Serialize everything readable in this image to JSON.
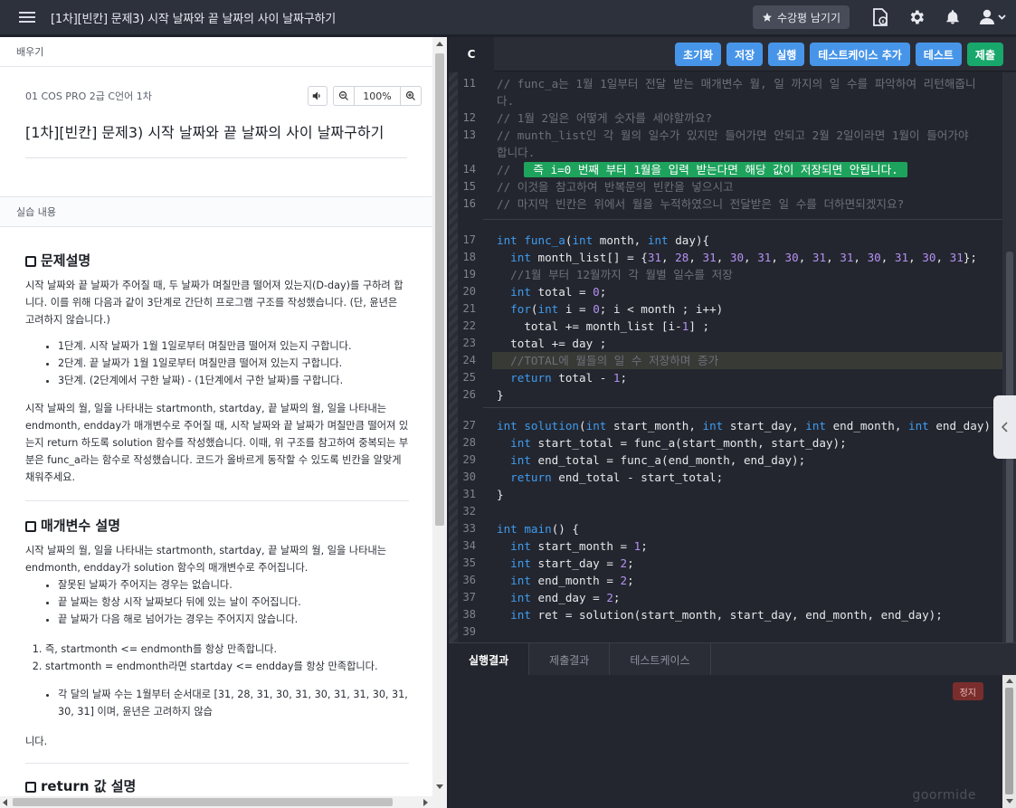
{
  "topbar": {
    "title": "[1차][빈칸] 문제3) 시작 날짜와 끝 날짜의 사이 날짜구하기",
    "review_label": "수강평 남기기"
  },
  "left": {
    "header": "배우기",
    "course_name": "01 COS PRO 2급 C언어 1차",
    "zoom_value": "100%",
    "problem_title": "[1차][빈칸] 문제3) 시작 날짜와 끝 날짜의 사이 날짜구하기",
    "section_label": "실습 내용",
    "desc_heading": "문제설명",
    "desc_p1": "시작 날짜와 끝 날짜가 주어질 때, 두 날짜가 며칠만큼 떨어져 있는지(D-day)를 구하려 합니다. 이를 위해 다음과 같이 3단계로 간단히 프로그램 구조를 작성했습니다. (단, 윤년은 고려하지 않습니다.)",
    "desc_steps": [
      "1단계. 시작 날짜가 1월 1일로부터 며칠만큼 떨어져 있는지 구합니다.",
      "2단계. 끝 날짜가 1월 1일로부터 며칠만큼 떨어져 있는지 구합니다.",
      "3단계. (2단계에서 구한 날짜) - (1단계에서 구한 날짜)를 구합니다."
    ],
    "desc_p2": "시작 날짜의 월, 일을 나타내는 startmonth, startday, 끝 날짜의 월, 일을 나타내는 endmonth, endday가 매개변수로 주어질 때, 시작 날짜와 끝 날짜가 며칠만큼 떨어져 있는지 return 하도록 solution 함수를 작성했습니다. 이때, 위 구조를 참고하여 중복되는 부분은 func_a라는 함수로 작성했습니다. 코드가 올바르게 동작할 수 있도록 빈칸을 알맞게 채워주세요.",
    "param_heading": "매개변수 설명",
    "param_p1": "시작 날짜의 월, 일을 나타내는 startmonth, startday, 끝 날짜의 월, 일을 나타내는 endmonth, endday가 solution 함수의 매개변수로 주어집니다.",
    "param_bullets": [
      "잘못된 날짜가 주어지는 경우는 없습니다.",
      "끝 날짜는 항상 시작 날짜보다 뒤에 있는 날이 주어집니다.",
      "끝 날짜가 다음 해로 넘어가는 경우는 주어지지 않습니다."
    ],
    "param_numbered": [
      "즉, startmonth <= endmonth를 항상 만족합니다.",
      "startmonth = endmonth라면 startday <= endday를 항상 만족합니다."
    ],
    "param_bullet2": "각 달의 날짜 수는 1월부터 순서대로 [31, 28, 31, 30, 31, 30, 31, 31, 30, 31, 30, 31] 이며, 윤년은 고려하지 않습",
    "param_tail": "니다.",
    "return_heading": "return 값 설명"
  },
  "editor": {
    "tab_label": "C",
    "buttons": [
      "초기화",
      "저장",
      "실행",
      "테스트케이스 추가",
      "테스트",
      "제출"
    ]
  },
  "output": {
    "tabs": [
      "실행결과",
      "제출결과",
      "테스트케이스"
    ],
    "stop_label": "정지",
    "brand": "goormide"
  }
}
